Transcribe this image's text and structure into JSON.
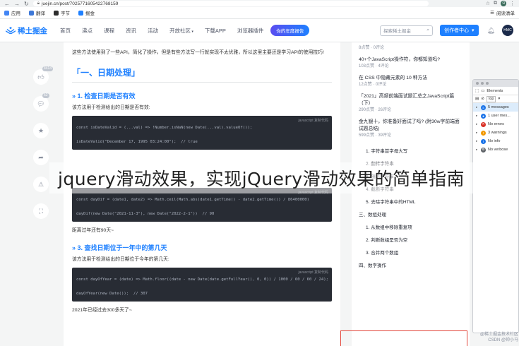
{
  "browser": {
    "url": "juejin.cn/post/7025771605422768159",
    "bookmarks": [
      {
        "label": "应用",
        "color": "#4285f4"
      },
      {
        "label": "翻译",
        "color": "#3c78d8"
      },
      {
        "label": "字节",
        "color": "#2c2c2c"
      },
      {
        "label": "掘金",
        "color": "#1e80ff"
      }
    ],
    "reading_list": "阅读清单",
    "profile_initial": "Я"
  },
  "header": {
    "logo_text": "稀土掘金",
    "nav": [
      {
        "label": "首页",
        "active": false
      },
      {
        "label": "沸点",
        "active": false
      },
      {
        "label": "课程",
        "active": false
      },
      {
        "label": "资讯",
        "active": false
      },
      {
        "label": "活动",
        "active": false
      },
      {
        "label": "开放社区",
        "active": false
      },
      {
        "label": "下载APP",
        "active": false
      },
      {
        "label": "浏览器插件",
        "active": false
      }
    ],
    "promo": "你的年度报告",
    "search_placeholder": "探索稀土掘金",
    "creator_label": "创作者中心",
    "avatar_text": "HMC"
  },
  "actions": [
    {
      "name": "like",
      "badge": "4414"
    },
    {
      "name": "comment",
      "badge": "52"
    },
    {
      "name": "collect",
      "badge": ""
    },
    {
      "name": "share",
      "badge": ""
    },
    {
      "name": "report",
      "badge": ""
    },
    {
      "name": "fullscreen",
      "badge": ""
    }
  ],
  "article": {
    "intro": "这些方法使用到了一些API，简化了操作，但是有些方法写一行就实现不太优雅，所以这里主要还是学习API的使用技巧!",
    "section_title": "「一、日期处理」",
    "sub1_title": "» 1. 检查日期是否有效",
    "sub1_desc": "该方法用于检测给出的日期是否有效:",
    "code_tag": "javascript  复制代码",
    "code1": [
      "const isDateValid = (...val) => !Number.isNaN(new Date(...val).valueOf());",
      "",
      "isDateValid(\"December 17, 1995 03:24:00\");  // true"
    ],
    "code2": [
      "const dayDif = (date1, date2) => Math.ceil(Math.abs(date1.getTime() - date2.getTime()) / 86400000)",
      "",
      "dayDif(new Date(\"2021-11-3\"), new Date(\"2022-2-1\"))  // 90"
    ],
    "result2": "距离过年还有90天~",
    "sub3_title": "» 3. 查找日期位于一年中的第几天",
    "sub3_desc": "该方法用于检测给出的日期位于今年的第几天:",
    "code3": [
      "const dayOfYear = (date) => Math.floor((date - new Date(date.getFullYear(), 0, 0)) / 1000 / 60 / 60 / 24);",
      "",
      "dayOfYear(new Date());  // 307"
    ],
    "result3": "2021年已经过去300多天了~"
  },
  "sidebar": {
    "related": [
      {
        "title": "",
        "meta": "8点赞 · 0评论"
      },
      {
        "title": "40+个JavaScript操作符，你都知道吗?",
        "meta": "103点赞 · 4评论"
      },
      {
        "title": "在 CSS 中隐藏元素的 10 种方法",
        "meta": "12点赞 · 0评论"
      },
      {
        "title": "「2021」高频前端面试题汇总之JavaScript篇（下）",
        "meta": "290点赞 · 26评论"
      },
      {
        "title": "金九银十，你准备好面试了吗? (附30w字前端面试题总结)",
        "meta": "599点赞 · 39评论"
      }
    ],
    "toc": [
      {
        "label": "1. 字符串首字母大写",
        "level": 2
      },
      {
        "label": "2. 翻转字符串",
        "level": 2
      },
      {
        "label": "3. 随机字符串",
        "level": 2
      },
      {
        "label": "4. 截断字符串",
        "level": 2
      },
      {
        "label": "5. 去除字符串中的HTML",
        "level": 2
      },
      {
        "label": "三、数组处理",
        "level": 1
      },
      {
        "label": "1. 从数组中移除重复项",
        "level": 2
      },
      {
        "label": "2. 判断数组是否为空",
        "level": 2
      },
      {
        "label": "3. 合并两个数组",
        "level": 2
      },
      {
        "label": "四、数字操作",
        "level": 1
      }
    ]
  },
  "devtools": {
    "tab": "Elements",
    "context": "top",
    "rows": [
      {
        "label": "5 messages",
        "color": "#1a73e8"
      },
      {
        "label": "1 user mes...",
        "color": "#1a73e8"
      },
      {
        "label": "No errors",
        "color": "#d93025"
      },
      {
        "label": "3 warnings",
        "color": "#f29900"
      },
      {
        "label": "No info",
        "color": "#1a73e8"
      },
      {
        "label": "No verbose",
        "color": "#5f6368"
      }
    ]
  },
  "overlay_title": "jquery滑动效果，实现jQuery滑动效果的简单指南",
  "watermark": [
    "@稀土掘金技术社区",
    "CSDN @帅小马"
  ]
}
